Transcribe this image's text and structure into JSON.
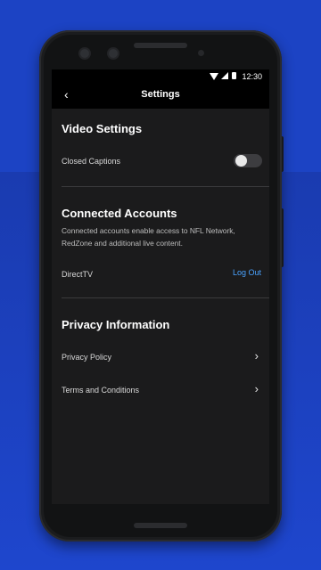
{
  "status_bar": {
    "time": "12:30"
  },
  "app_bar": {
    "title": "Settings"
  },
  "video_settings": {
    "title": "Video Settings",
    "closed_captions_label": "Closed Captions",
    "closed_captions_enabled": false
  },
  "connected_accounts": {
    "title": "Connected Accounts",
    "description": "Connected accounts enable access to NFL Network, RedZone and additional live content.",
    "provider_label": "DirectTV",
    "action_label": "Log Out",
    "action_color": "#4aa3ff"
  },
  "privacy": {
    "title": "Privacy Information",
    "items": [
      {
        "label": "Privacy Policy"
      },
      {
        "label": "Terms and Conditions"
      }
    ]
  },
  "colors": {
    "background_blue": "#1c43c4",
    "screen_bg": "#1b1b1c",
    "link_blue": "#4aa3ff"
  }
}
